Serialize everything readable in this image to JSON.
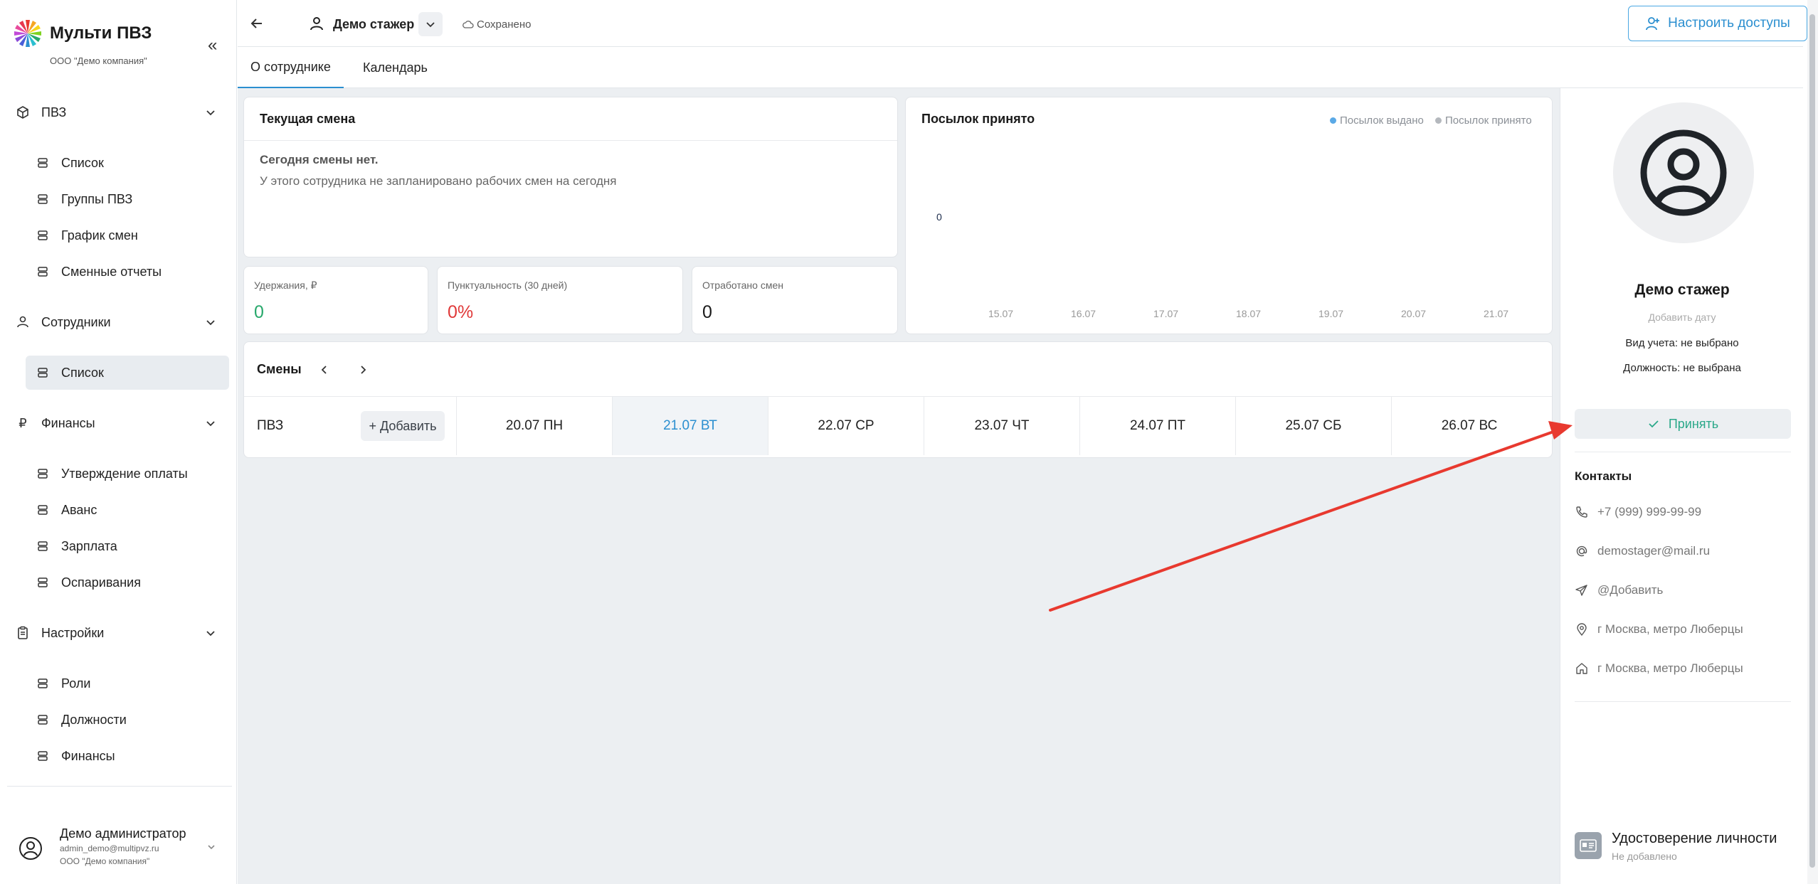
{
  "brand": {
    "title": "Мульти ПВЗ",
    "company": "ООО \"Демо компания\""
  },
  "sidebar": {
    "sections": [
      {
        "label": "ПВЗ",
        "items": [
          "Список",
          "Группы ПВЗ",
          "График смен",
          "Сменные отчеты"
        ]
      },
      {
        "label": "Сотрудники",
        "items": [
          "Список"
        ]
      },
      {
        "label": "Финансы",
        "items": [
          "Утверждение оплаты",
          "Аванс",
          "Зарплата",
          "Оспаривания"
        ]
      },
      {
        "label": "Настройки",
        "items": [
          "Роли",
          "Должности",
          "Финансы"
        ]
      }
    ],
    "active_item": "Сотрудники / Список"
  },
  "user": {
    "name": "Демо администратор",
    "email": "admin_demo@multipvz.ru",
    "company": "ООО \"Демо компания\""
  },
  "topbar": {
    "employee_name": "Демо стажер",
    "saved_label": "Сохранено",
    "access_button": "Настроить доступы"
  },
  "tabs": [
    {
      "label": "О сотруднике",
      "active": true
    },
    {
      "label": "Календарь",
      "active": false
    }
  ],
  "current_shift": {
    "title": "Текущая смена",
    "none_title": "Сегодня смены нет.",
    "none_desc": "У этого сотрудника не запланировано рабочих смен на сегодня"
  },
  "metrics": [
    {
      "label": "Удержания, ₽",
      "value": "0",
      "color": "#27a86b"
    },
    {
      "label": "Пунктуальность (30 дней)",
      "value": "0%",
      "color": "#e03a3a"
    },
    {
      "label": "Отработано смен",
      "value": "0",
      "color": "#1a1a1a"
    }
  ],
  "chart_data": {
    "type": "line",
    "title": "Посылок принято",
    "x": [
      "15.07",
      "16.07",
      "17.07",
      "18.07",
      "19.07",
      "20.07",
      "21.07"
    ],
    "series": [
      {
        "name": "Посылок выдано",
        "color": "#5aa9e6"
      },
      {
        "name": "Посылок принято",
        "color": "#b4b8bd"
      }
    ],
    "y_label_shown": "0"
  },
  "shifts": {
    "title": "Смены",
    "row_label": "ПВЗ",
    "add_button": "+ Добавить",
    "days": [
      "20.07 ПН",
      "21.07 ВТ",
      "22.07 СР",
      "23.07 ЧТ",
      "24.07 ПТ",
      "25.07 СБ",
      "26.07 ВС"
    ],
    "today": "21.07 ВТ"
  },
  "profile": {
    "name": "Демо стажер",
    "add_date": "Добавить дату",
    "account_type": "Вид учета: не выбрано",
    "position": "Должность: не выбрана",
    "accept_button": "Принять",
    "contacts_title": "Контакты",
    "contacts": [
      {
        "icon": "phone-icon",
        "text": "+7 (999) 999-99-99"
      },
      {
        "icon": "at-icon",
        "text": "demostager@mail.ru"
      },
      {
        "icon": "telegram-icon",
        "text": "@Добавить"
      },
      {
        "icon": "location-icon",
        "text": "г Москва, метро Люберцы"
      },
      {
        "icon": "home-icon",
        "text": "г Москва, метро Люберцы"
      }
    ],
    "id_title": "Удостоверение личности",
    "id_sub": "Не добавлено"
  },
  "colors": {
    "accent": "#2b8fd0",
    "accept": "#2aa889",
    "annotation_arrow": "#e8392f"
  }
}
